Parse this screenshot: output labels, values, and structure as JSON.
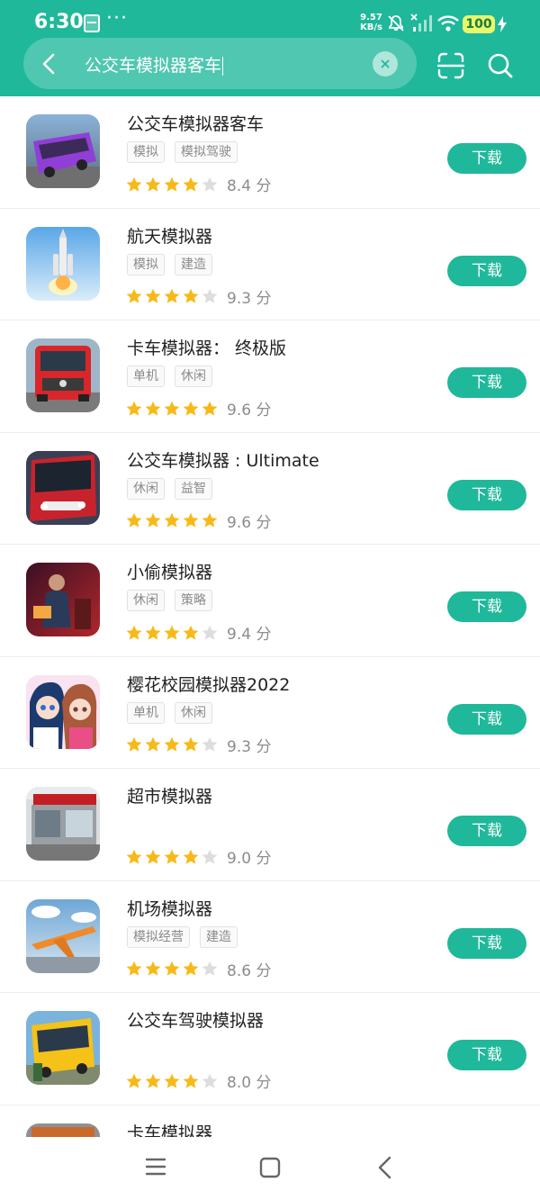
{
  "status_bar": {
    "time": "6:30",
    "more": "···",
    "net_speed_value": "9.57",
    "net_speed_unit": "KB/s",
    "battery": "100"
  },
  "search": {
    "query": "公交车模拟器客车"
  },
  "download_label": "下载",
  "apps": [
    {
      "name": "公交车模拟器客车",
      "tags": [
        "模拟",
        "模拟驾驶"
      ],
      "rating": 4,
      "score": "8.4 分",
      "icon": "purple-bus"
    },
    {
      "name": "航天模拟器",
      "tags": [
        "模拟",
        "建造"
      ],
      "rating": 4.5,
      "score": "9.3 分",
      "icon": "rocket"
    },
    {
      "name": "卡车模拟器： 终极版",
      "tags": [
        "单机",
        "休闲"
      ],
      "rating": 5,
      "score": "9.6 分",
      "icon": "red-truck"
    },
    {
      "name": "公交车模拟器 : Ultimate",
      "tags": [
        "休闲",
        "益智"
      ],
      "rating": 5,
      "score": "9.6 分",
      "icon": "red-bus"
    },
    {
      "name": "小偷模拟器",
      "tags": [
        "休闲",
        "策略"
      ],
      "rating": 4.5,
      "score": "9.4 分",
      "icon": "thief"
    },
    {
      "name": "樱花校园模拟器2022",
      "tags": [
        "单机",
        "休闲"
      ],
      "rating": 4.5,
      "score": "9.3 分",
      "icon": "anime"
    },
    {
      "name": "超市模拟器",
      "tags": [],
      "rating": 4.5,
      "score": "9.0 分",
      "icon": "supermarket"
    },
    {
      "name": "机场模拟器",
      "tags": [
        "模拟经营",
        "建造"
      ],
      "rating": 4.5,
      "score": "8.6 分",
      "icon": "airplane"
    },
    {
      "name": "公交车驾驶模拟器",
      "tags": [],
      "rating": 4,
      "score": "8.0 分",
      "icon": "yellow-bus"
    },
    {
      "name": "卡车模拟器",
      "tags": [],
      "rating": 0,
      "score": "",
      "icon": "truck-partial"
    }
  ],
  "colors": {
    "accent": "#1fb89a",
    "star": "#f8b918",
    "star_empty": "#dddddd",
    "battery_bg": "#e9f86b"
  },
  "icons": [
    "back-icon",
    "clear-icon",
    "scan-icon",
    "search-icon",
    "bell-muted-icon",
    "signal-icon",
    "wifi-icon",
    "bolt-icon",
    "menu-icon",
    "home-icon",
    "nav-back-icon"
  ]
}
